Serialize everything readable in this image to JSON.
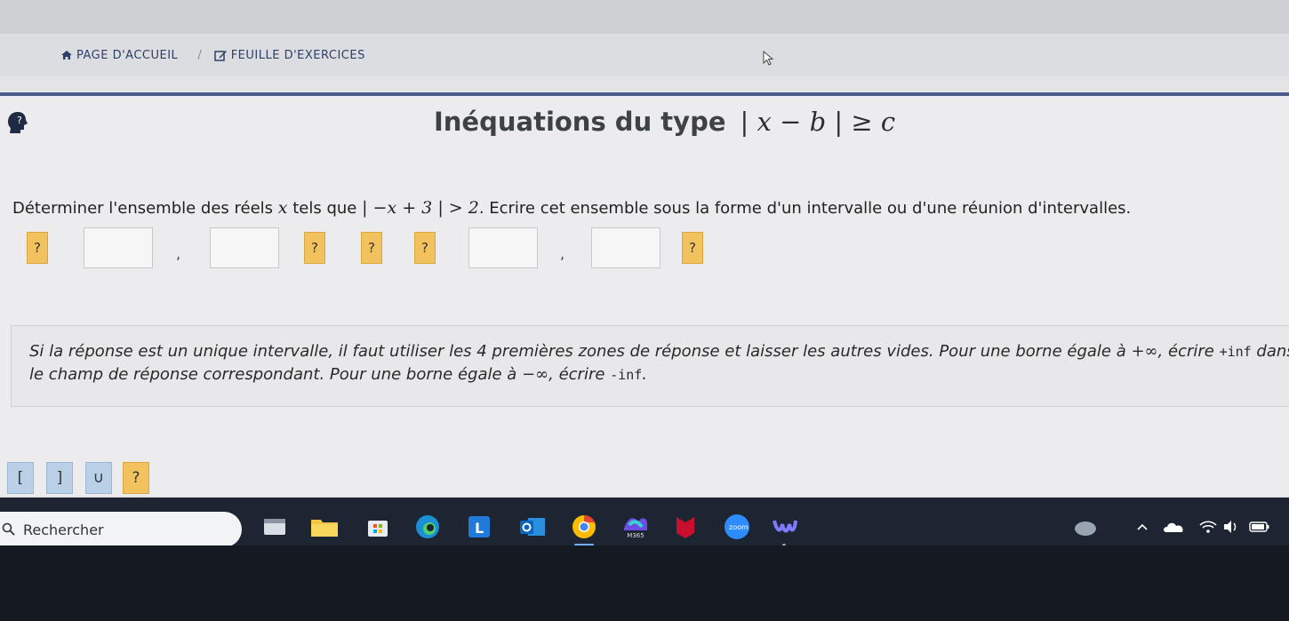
{
  "breadcrumb": {
    "home_label": "PAGE D'ACCUEIL",
    "separator": "/",
    "exercises_label": "FEUILLE D'EXERCICES"
  },
  "title": {
    "text": "Inéquations du type",
    "math": "| x − b | ≥ c"
  },
  "question": {
    "prefix": "Déterminer l'ensemble des réels ",
    "var": "x",
    "middle": " tels que ",
    "math": "| −x + 3 | > 2",
    "suffix": ". Ecrire cet ensemble sous la forme d'un intervalle ou d'une réunion d'intervalles."
  },
  "answer_row": {
    "placeholder": "?",
    "comma": ","
  },
  "hint": {
    "part1": "Si la réponse est un unique intervalle, il faut utiliser les 4 premières zones de réponse et laisser les autres vides. Pour une borne égale à ",
    "plus_inf_symbol": "+∞",
    "part2": ", écrire ",
    "plus_inf_code": "+inf",
    "part3": " dans le champ de réponse correspondant. Pour une borne égale à ",
    "minus_inf_symbol": "−∞",
    "part4": ", écrire ",
    "minus_inf_code": "-inf",
    "part5": "."
  },
  "keypad": {
    "open_bracket": "[",
    "close_bracket": "]",
    "union": "∪",
    "help": "?"
  },
  "taskbar": {
    "search_label": "Rechercher",
    "m365_label": "M365",
    "zoom_label": "zoom"
  },
  "colors": {
    "accent": "#4b5a8c",
    "button_yellow": "#f1c25e",
    "key_blue": "#b9d0e6",
    "taskbar": "#1d2532"
  }
}
